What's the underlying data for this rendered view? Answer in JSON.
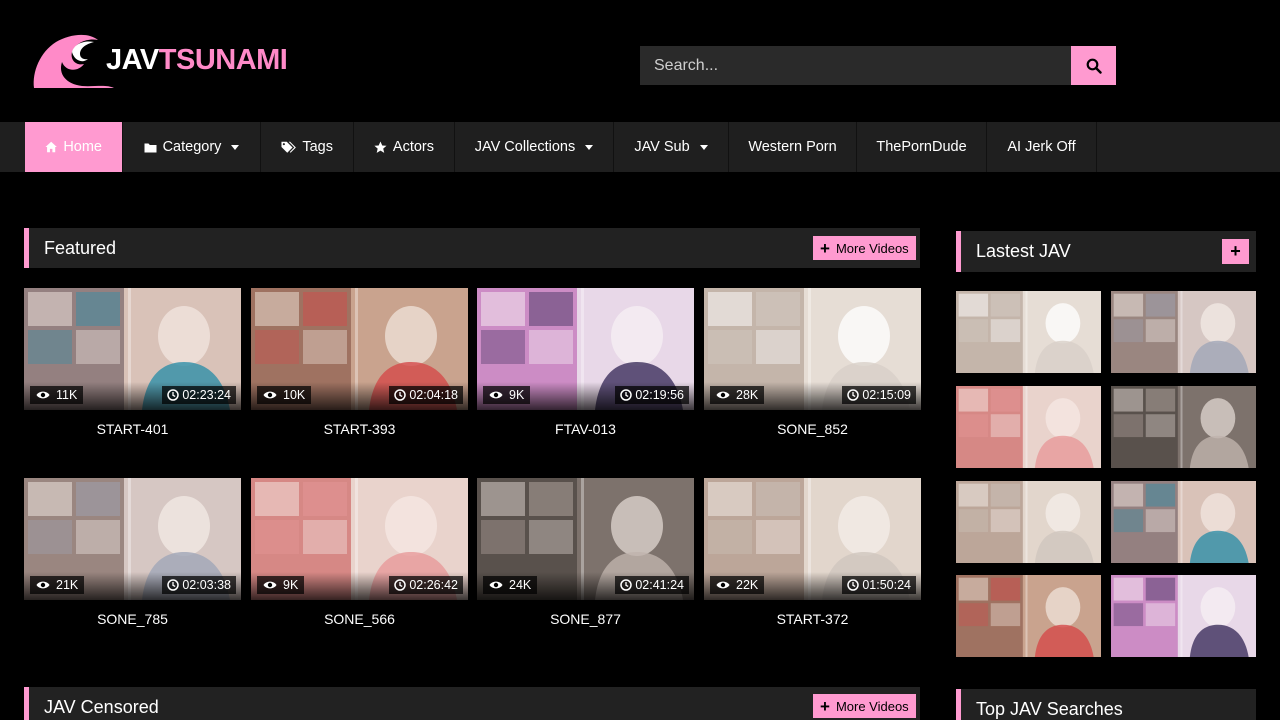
{
  "site": {
    "logo_white": "JAV",
    "logo_pink": "TSUNAMI"
  },
  "search": {
    "placeholder": "Search..."
  },
  "nav": {
    "items": [
      {
        "label": "Home",
        "icon": "home-icon",
        "active": true,
        "dropdown": false
      },
      {
        "label": "Category",
        "icon": "folder-icon",
        "active": false,
        "dropdown": true
      },
      {
        "label": "Tags",
        "icon": "tags-icon",
        "active": false,
        "dropdown": false
      },
      {
        "label": "Actors",
        "icon": "star-icon",
        "active": false,
        "dropdown": false
      },
      {
        "label": "JAV Collections",
        "icon": "",
        "active": false,
        "dropdown": true
      },
      {
        "label": "JAV Sub",
        "icon": "",
        "active": false,
        "dropdown": true
      },
      {
        "label": "Western Porn",
        "icon": "",
        "active": false,
        "dropdown": false
      },
      {
        "label": "ThePornDude",
        "icon": "",
        "active": false,
        "dropdown": false
      },
      {
        "label": "AI Jerk Off",
        "icon": "",
        "active": false,
        "dropdown": false
      }
    ]
  },
  "featured": {
    "title": "Featured",
    "more_label": "More Videos",
    "videos": [
      {
        "title": "START-401",
        "views": "11K",
        "duration": "02:23:24"
      },
      {
        "title": "START-393",
        "views": "10K",
        "duration": "02:04:18"
      },
      {
        "title": "FTAV-013",
        "views": "9K",
        "duration": "02:19:56"
      },
      {
        "title": "SONE_852",
        "views": "28K",
        "duration": "02:15:09"
      },
      {
        "title": "SONE_785",
        "views": "21K",
        "duration": "02:03:38"
      },
      {
        "title": "SONE_566",
        "views": "9K",
        "duration": "02:26:42"
      },
      {
        "title": "SONE_877",
        "views": "24K",
        "duration": "02:41:24"
      },
      {
        "title": "START-372",
        "views": "22K",
        "duration": "01:50:24"
      }
    ]
  },
  "censored": {
    "title": "JAV Censored",
    "more_label": "More Videos"
  },
  "sidebar": {
    "latest_title": "Lastest JAV",
    "latest_plus": "+",
    "top_searches_title": "Top JAV Searches"
  },
  "colors": {
    "accent": "#ff9ad0",
    "panel": "#222222",
    "nav_bg": "#1f1f1f"
  }
}
